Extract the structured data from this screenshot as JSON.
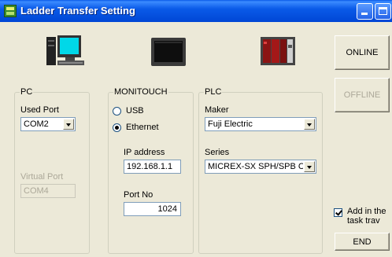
{
  "window": {
    "title": "Ladder Transfer Setting"
  },
  "buttons": {
    "online": "ONLINE",
    "offline": "OFFLINE",
    "end": "END"
  },
  "pc": {
    "group_label": "PC",
    "used_port_label": "Used Port",
    "used_port_value": "COM2",
    "virtual_port_label": "Virtual Port",
    "virtual_port_value": "COM4"
  },
  "monitouch": {
    "group_label": "MONITOUCH",
    "usb_label": "USB",
    "ethernet_label": "Ethernet",
    "selected": "Ethernet",
    "ip_label": "IP address",
    "ip_value": "192.168.1.1",
    "port_label": "Port No",
    "port_value": "1024"
  },
  "plc": {
    "group_label": "PLC",
    "maker_label": "Maker",
    "maker_value": "Fuji Electric",
    "series_label": "Series",
    "series_value": "MICREX-SX SPH/SPB CF"
  },
  "task_tray": {
    "label_line1": "Add in the",
    "label_line2": "task trav",
    "checked": true
  },
  "icons": [
    "pc-computer-icon",
    "monitouch-screen-icon",
    "plc-unit-icon"
  ]
}
